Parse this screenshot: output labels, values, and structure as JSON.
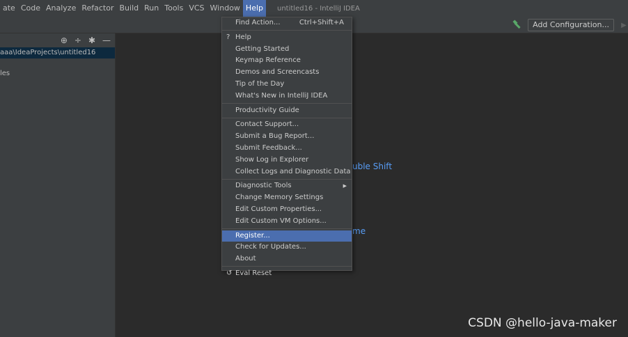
{
  "menubar": {
    "items": [
      "ate",
      "Code",
      "Analyze",
      "Refactor",
      "Build",
      "Run",
      "Tools",
      "VCS",
      "Window",
      "Help"
    ],
    "window_title": "untitled16 - IntelliJ IDEA"
  },
  "toolbar": {
    "add_configuration": "Add Configuration...",
    "icons": [
      "hammer-icon",
      "run-icon"
    ]
  },
  "project_panel": {
    "root_path": "aaa\\IdeaProjects\\untitled16",
    "external_libs": "les",
    "header_icons": [
      "locate-icon",
      "collapse-icon",
      "gear-icon",
      "minimize-icon"
    ]
  },
  "editor": {
    "hint_shift": "uble Shift",
    "hint_home": "me"
  },
  "help_menu": {
    "find_action": "Find Action...",
    "find_action_shortcut": "Ctrl+Shift+A",
    "help": "Help",
    "getting_started": "Getting Started",
    "keymap_reference": "Keymap Reference",
    "demos": "Demos and Screencasts",
    "tip_of_day": "Tip of the Day",
    "whats_new": "What's New in IntelliJ IDEA",
    "productivity_guide": "Productivity Guide",
    "contact_support": "Contact Support...",
    "submit_bug": "Submit a Bug Report...",
    "submit_feedback": "Submit Feedback...",
    "show_log": "Show Log in Explorer",
    "collect_logs": "Collect Logs and Diagnostic Data",
    "diagnostic_tools": "Diagnostic Tools",
    "change_memory": "Change Memory Settings",
    "edit_properties": "Edit Custom Properties...",
    "edit_vm_options": "Edit Custom VM Options...",
    "register": "Register...",
    "check_updates": "Check for Updates...",
    "about": "About",
    "eval_reset": "Eval Reset"
  },
  "watermark": "CSDN @hello-java-maker",
  "colors": {
    "menu_bg": "#3c3f41",
    "editor_bg": "#2b2b2b",
    "selection": "#4b6eaf",
    "project_selection": "#0d293e",
    "hint_blue": "#589df6"
  }
}
